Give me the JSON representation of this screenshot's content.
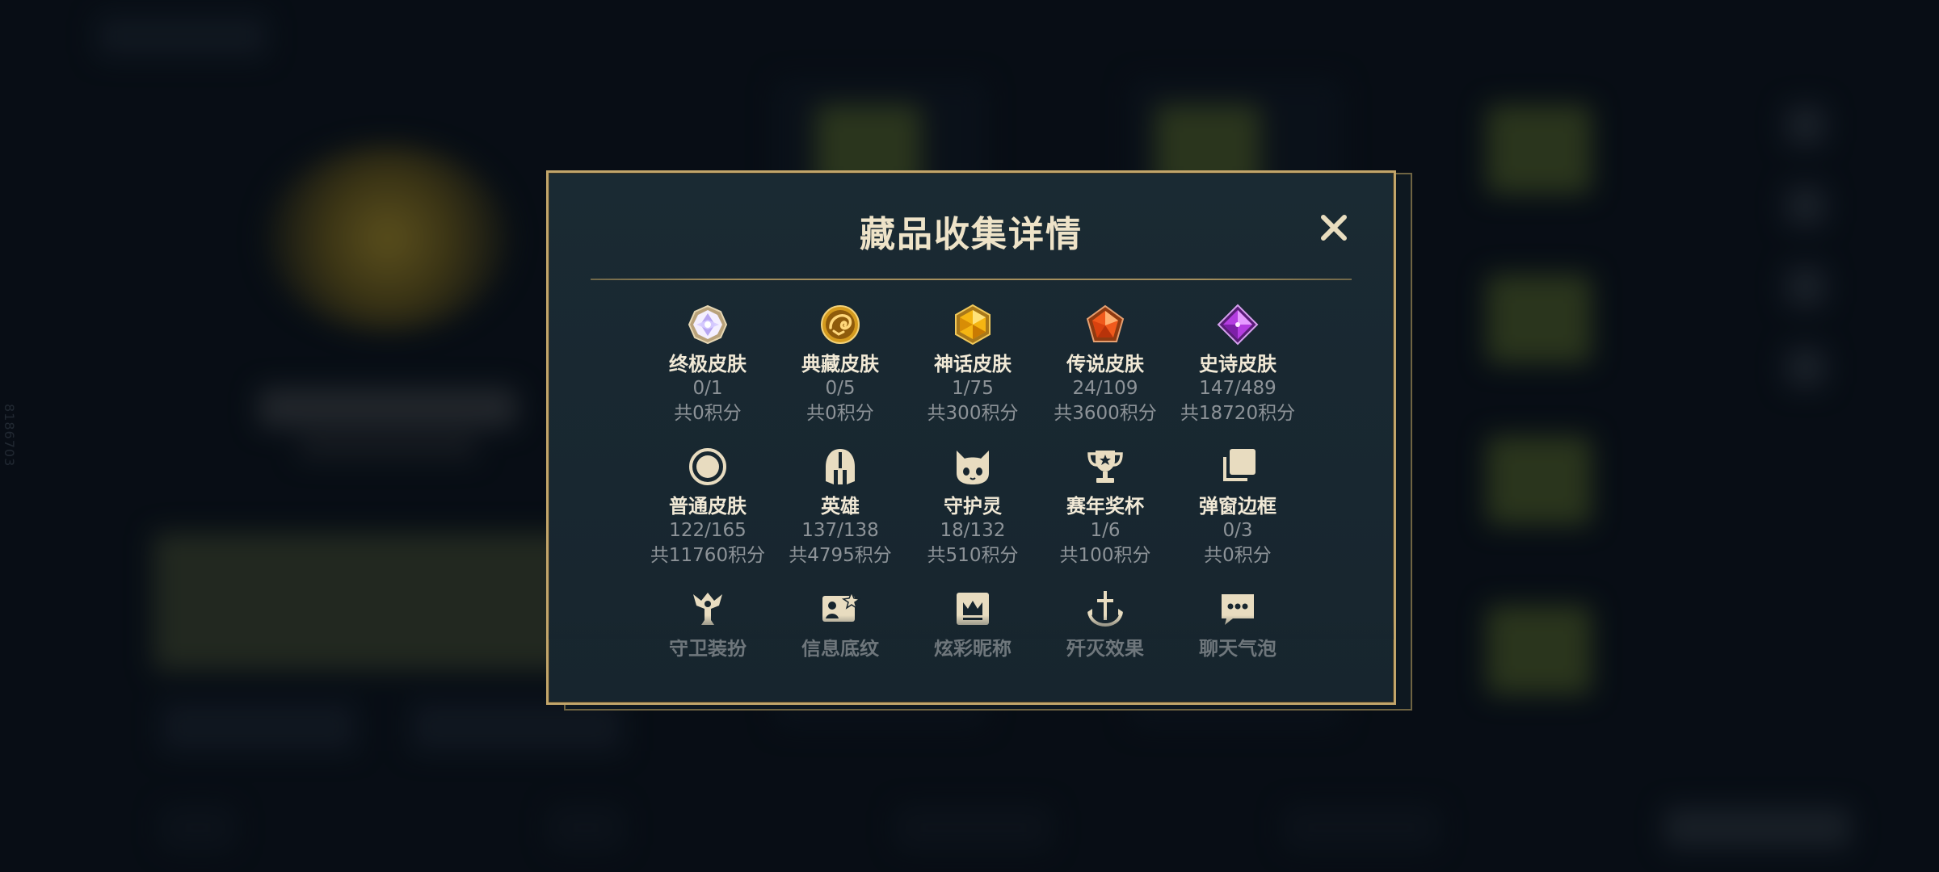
{
  "side_id": "8186703",
  "dialog": {
    "title": "藏品收集详情",
    "close_icon": "close-icon"
  },
  "colors": {
    "accent_gold": "#c2a56a",
    "title_text": "#eee3c8",
    "muted_text": "#8d9398",
    "dialog_bg": "#17252e"
  },
  "items": [
    {
      "label": "终极皮肤",
      "count": "0/1",
      "points": "共0积分",
      "icon": "ultimate-gem-icon"
    },
    {
      "label": "典藏皮肤",
      "count": "0/5",
      "points": "共0积分",
      "icon": "dragon-emblem-icon"
    },
    {
      "label": "神话皮肤",
      "count": "1/75",
      "points": "共300积分",
      "icon": "gold-gem-icon"
    },
    {
      "label": "传说皮肤",
      "count": "24/109",
      "points": "共3600积分",
      "icon": "orange-gem-icon"
    },
    {
      "label": "史诗皮肤",
      "count": "147/489",
      "points": "共18720积分",
      "icon": "purple-gem-icon"
    },
    {
      "label": "普通皮肤",
      "count": "122/165",
      "points": "共11760积分",
      "icon": "ring-icon"
    },
    {
      "label": "英雄",
      "count": "137/138",
      "points": "共4795积分",
      "icon": "helmet-icon"
    },
    {
      "label": "守护灵",
      "count": "18/132",
      "points": "共510积分",
      "icon": "guardian-pet-icon"
    },
    {
      "label": "赛年奖杯",
      "count": "1/6",
      "points": "共100积分",
      "icon": "trophy-icon"
    },
    {
      "label": "弹窗边框",
      "count": "0/3",
      "points": "共0积分",
      "icon": "frame-stack-icon"
    },
    {
      "label": "守卫装扮",
      "icon": "ward-icon"
    },
    {
      "label": "信息底纹",
      "icon": "info-card-icon"
    },
    {
      "label": "炫彩昵称",
      "icon": "crown-card-icon"
    },
    {
      "label": "歼灭效果",
      "icon": "anchor-sword-icon"
    },
    {
      "label": "聊天气泡",
      "icon": "chat-bubble-icon"
    }
  ]
}
